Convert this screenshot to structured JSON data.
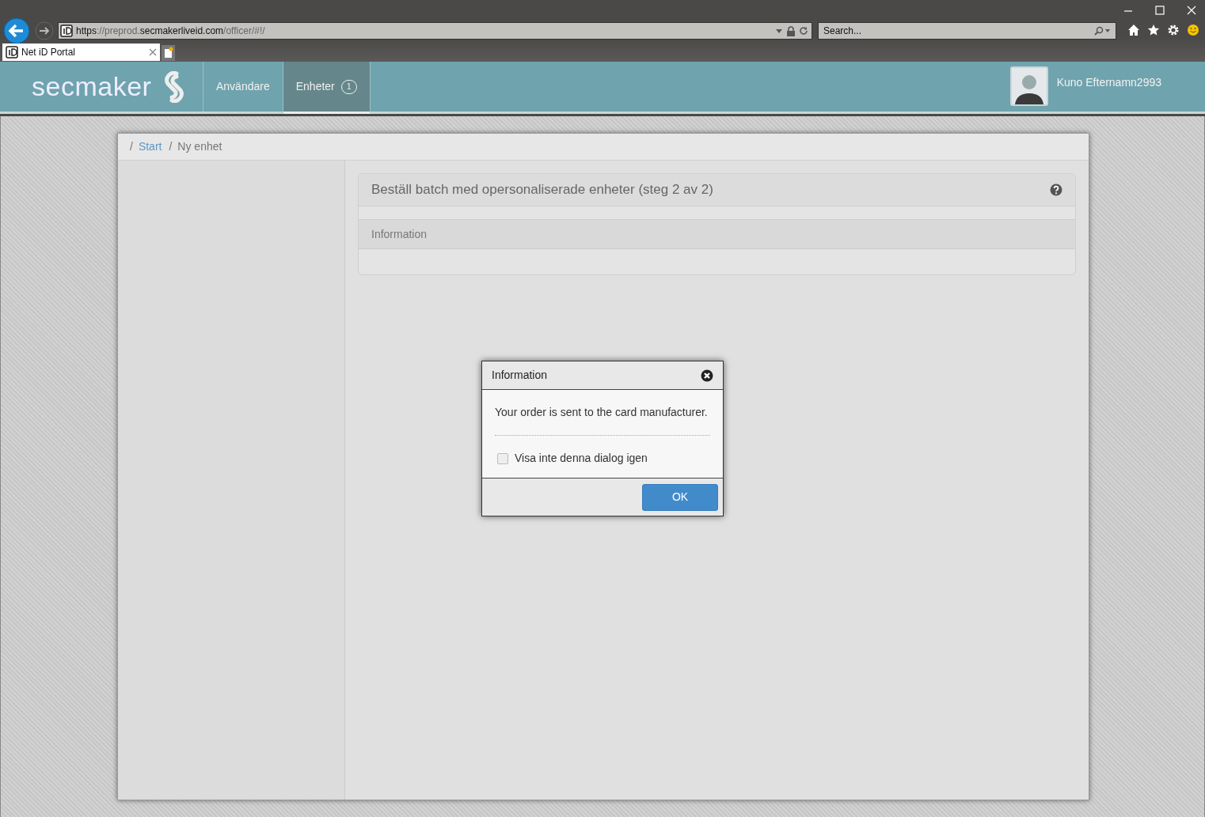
{
  "browser": {
    "address": [
      {
        "text": "https",
        "strong": true
      },
      {
        "text": "://preprod.",
        "strong": false
      },
      {
        "text": "secmakerliveid.com",
        "strong": true
      },
      {
        "text": "/officer/#!/",
        "strong": false
      }
    ],
    "search": {
      "placeholder": "Search..."
    },
    "tabs": [
      {
        "label": "Net iD Portal",
        "selected": true
      }
    ]
  },
  "header": {
    "logo": "secmaker",
    "nav": [
      {
        "label": "Användare",
        "selected": false
      },
      {
        "label": "Enheter",
        "selected": true,
        "badge": "1"
      }
    ],
    "user": "Kuno Efternamn2993"
  },
  "breadcrumb": [
    {
      "separator": "/",
      "label": "Start",
      "link": true
    },
    {
      "separator": "/",
      "label": "Ny enhet",
      "link": false
    }
  ],
  "card": {
    "title": "Beställ batch med opersonaliserade enheter (steg 2 av 2)",
    "section": "Information"
  },
  "dialog": {
    "title": "Information",
    "message": "Your order is sent to the card manufacturer.",
    "checkbox": {
      "label": "Visa inte denna dialog igen",
      "checked": false
    },
    "button": "OK"
  }
}
